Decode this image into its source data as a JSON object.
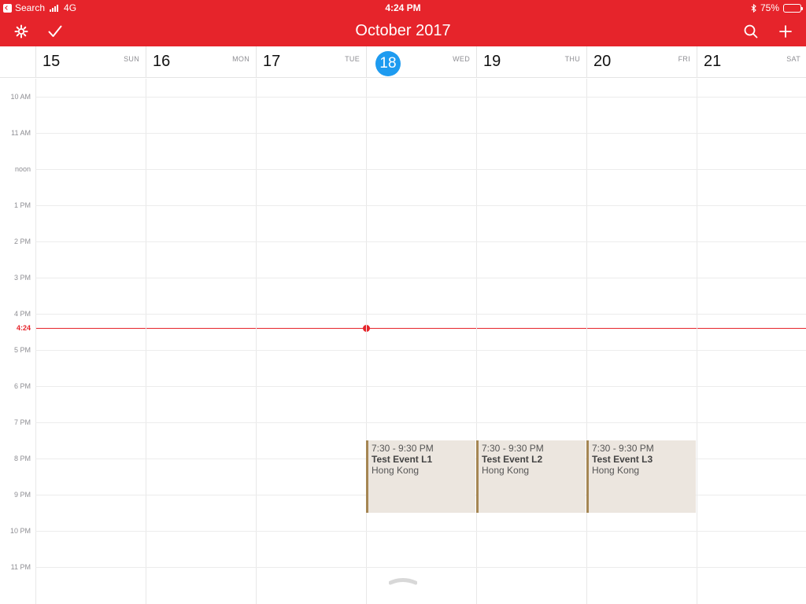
{
  "status": {
    "back_label": "Search",
    "network": "4G",
    "time": "4:24 PM",
    "battery": "75%",
    "battery_level": 0.75
  },
  "nav": {
    "title": "October 2017",
    "icons": [
      "gear-icon",
      "checkmark-icon",
      "search-icon",
      "plus-icon"
    ]
  },
  "days": [
    {
      "num": "15",
      "name": "SUN",
      "today": false
    },
    {
      "num": "16",
      "name": "MON",
      "today": false
    },
    {
      "num": "17",
      "name": "TUE",
      "today": false
    },
    {
      "num": "18",
      "name": "WED",
      "today": true
    },
    {
      "num": "19",
      "name": "THU",
      "today": false
    },
    {
      "num": "20",
      "name": "FRI",
      "today": false
    },
    {
      "num": "21",
      "name": "SAT",
      "today": false
    }
  ],
  "hours": [
    "10 AM",
    "11 AM",
    "noon",
    "1 PM",
    "2 PM",
    "3 PM",
    "4 PM",
    "5 PM",
    "6 PM",
    "7 PM",
    "8 PM",
    "9 PM",
    "10 PM",
    "11 PM"
  ],
  "now": {
    "label": "4:24"
  },
  "events": [
    {
      "time": "7:30 - 9:30 PM",
      "title": "Test Event L1",
      "location": "Hong Kong"
    },
    {
      "time": "7:30 - 9:30 PM",
      "title": "Test Event L2",
      "location": "Hong Kong"
    },
    {
      "time": "7:30 - 9:30 PM",
      "title": "Test Event L3",
      "location": "Hong Kong"
    }
  ],
  "colors": {
    "accent": "#e6242b",
    "today": "#1e9bf0",
    "event_bg": "#ece6df",
    "event_border": "#a58653"
  }
}
